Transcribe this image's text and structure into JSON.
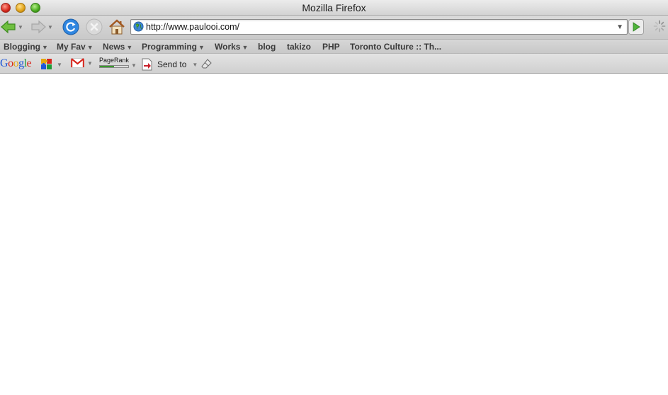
{
  "window": {
    "title": "Mozilla Firefox"
  },
  "navigation": {
    "url": "http://www.paulooi.com/",
    "icons": {
      "back": "back-arrow-icon",
      "forward": "forward-arrow-icon",
      "reload": "reload-icon",
      "stop": "stop-icon",
      "home": "home-icon",
      "go": "go-arrow-icon",
      "throbber": "loading-throbber-icon"
    }
  },
  "bookmarks": {
    "items": [
      {
        "label": "Blogging",
        "has_menu": "▼"
      },
      {
        "label": "My Fav",
        "has_menu": "▼"
      },
      {
        "label": "News",
        "has_menu": "▼"
      },
      {
        "label": "Programming",
        "has_menu": "▼"
      },
      {
        "label": "Works",
        "has_menu": "▼"
      },
      {
        "label": "blog"
      },
      {
        "label": "takizo"
      },
      {
        "label": "PHP"
      },
      {
        "label": "Toronto Culture :: Th..."
      }
    ]
  },
  "google_toolbar": {
    "logo": "Google",
    "pagerank_label": "PageRank",
    "pagerank_fraction": 0.5,
    "send_to_label": "Send to",
    "colors": {
      "g_blue": "#1d56d8",
      "g_red": "#d8261d",
      "g_yellow": "#e5a70d",
      "g_green": "#1f9a35"
    }
  }
}
